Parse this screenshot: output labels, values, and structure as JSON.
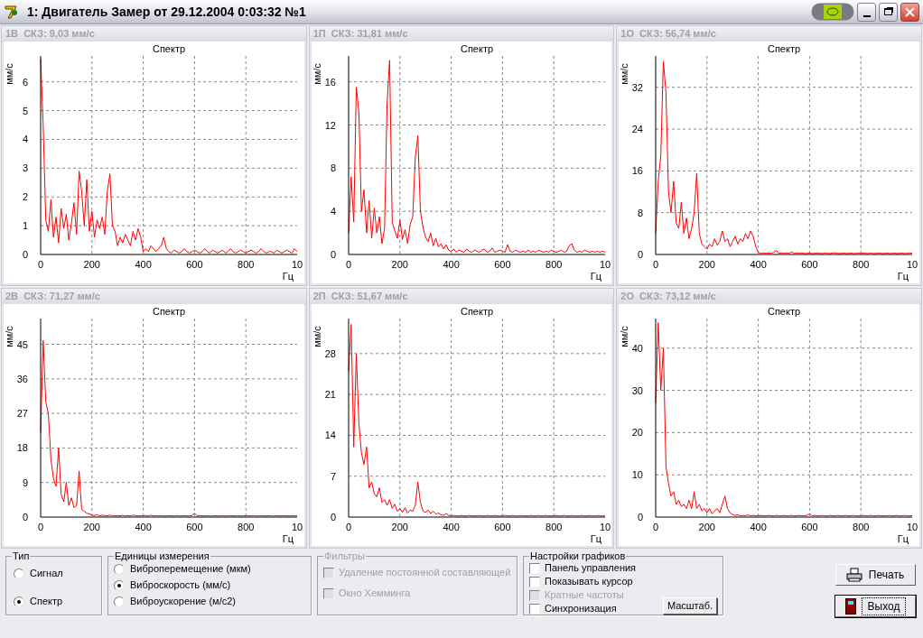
{
  "window": {
    "title": "1: Двигатель Замер от 29.12.2004 0:03:32  №1"
  },
  "charts": [
    {
      "header": "1В  СКЗ: 9,03 мм/с",
      "x_edge_label": "10",
      "chart_data": {
        "type": "line",
        "title": "Спектр",
        "xlabel": "Гц",
        "ylabel": "мм/с",
        "xlim": [
          0,
          1000
        ],
        "ylim": [
          0,
          6.9
        ],
        "grid": true,
        "xticks": [
          0,
          200,
          400,
          600,
          800
        ],
        "yticks": [
          0,
          1,
          2,
          3,
          4,
          5,
          6
        ],
        "x": [
          0,
          10,
          20,
          30,
          40,
          50,
          60,
          70,
          80,
          90,
          100,
          110,
          120,
          130,
          140,
          150,
          160,
          170,
          180,
          190,
          200,
          210,
          220,
          230,
          240,
          250,
          260,
          270,
          280,
          290,
          300,
          310,
          320,
          330,
          340,
          350,
          360,
          370,
          380,
          390,
          400,
          410,
          420,
          430,
          440,
          450,
          460,
          470,
          480,
          490,
          500,
          510,
          520,
          530,
          540,
          550,
          560,
          570,
          580,
          590,
          600,
          610,
          620,
          630,
          640,
          650,
          660,
          670,
          680,
          690,
          700,
          710,
          720,
          730,
          740,
          750,
          760,
          770,
          780,
          790,
          800,
          810,
          820,
          830,
          840,
          850,
          860,
          870,
          880,
          890,
          900,
          910,
          920,
          930,
          940,
          950,
          960,
          970,
          980,
          990,
          1000
        ],
        "series": [
          {
            "color": "#ff0000",
            "values": [
              6.8,
              4.5,
              1.2,
              0.8,
              1.9,
              0.6,
              1.3,
              0.4,
              1.6,
              0.9,
              1.4,
              0.5,
              1.1,
              1.8,
              0.7,
              2.9,
              2.2,
              1.0,
              2.6,
              0.8,
              1.5,
              0.6,
              1.2,
              0.9,
              1.3,
              0.7,
              2.2,
              2.8,
              1.0,
              0.8,
              0.3,
              0.6,
              0.4,
              0.7,
              0.5,
              0.3,
              0.8,
              0.5,
              0.9,
              0.6,
              0.1,
              0.2,
              0.1,
              0.3,
              0.2,
              0.1,
              0.2,
              0.3,
              0.6,
              0.2,
              0.1,
              0.05,
              0.15,
              0.1,
              0.05,
              0.1,
              0.2,
              0.1,
              0.05,
              0.1,
              0.15,
              0.1,
              0.05,
              0.1,
              0.2,
              0.1,
              0.05,
              0.15,
              0.1,
              0.05,
              0.1,
              0.15,
              0.05,
              0.1,
              0.2,
              0.1,
              0.05,
              0.1,
              0.15,
              0.1,
              0.05,
              0.1,
              0.15,
              0.1,
              0.05,
              0.1,
              0.2,
              0.1,
              0.05,
              0.1,
              0.1,
              0.05,
              0.15,
              0.1,
              0.05,
              0.1,
              0.15,
              0.1,
              0.05,
              0.2,
              0.1
            ]
          }
        ]
      }
    },
    {
      "header": "1П  СКЗ: 31,81 мм/с",
      "x_edge_label": "10",
      "chart_data": {
        "type": "line",
        "title": "Спектр",
        "xlabel": "Гц",
        "ylabel": "мм/с",
        "xlim": [
          0,
          1000
        ],
        "ylim": [
          0,
          18.4
        ],
        "grid": true,
        "xticks": [
          0,
          200,
          400,
          600,
          800
        ],
        "yticks": [
          0,
          4,
          8,
          12,
          16
        ],
        "x": [
          0,
          10,
          20,
          30,
          40,
          50,
          60,
          70,
          80,
          90,
          100,
          110,
          120,
          130,
          140,
          150,
          160,
          170,
          180,
          190,
          200,
          210,
          220,
          230,
          240,
          250,
          260,
          270,
          280,
          290,
          300,
          310,
          320,
          330,
          340,
          350,
          360,
          370,
          380,
          390,
          400,
          410,
          420,
          430,
          440,
          450,
          460,
          470,
          480,
          490,
          500,
          510,
          520,
          530,
          540,
          550,
          560,
          570,
          580,
          590,
          600,
          610,
          620,
          630,
          640,
          650,
          660,
          670,
          680,
          690,
          700,
          710,
          720,
          730,
          740,
          750,
          760,
          770,
          780,
          790,
          800,
          810,
          820,
          830,
          840,
          850,
          860,
          870,
          880,
          890,
          900,
          910,
          920,
          930,
          940,
          950,
          960,
          970,
          980,
          990,
          1000
        ],
        "series": [
          {
            "color": "#ff0000",
            "values": [
              2,
              7.2,
              3,
              15.5,
              13.2,
              4,
              6,
              2,
              5,
              1.5,
              4.3,
              2,
              3.5,
              1,
              2.4,
              14,
              18,
              3,
              2.2,
              1.5,
              3.2,
              1.4,
              2.3,
              1,
              2.8,
              3.5,
              9,
              11,
              4,
              2.5,
              1.6,
              1.2,
              2,
              0.8,
              1.5,
              0.7,
              1,
              0.5,
              0.9,
              0.4,
              0.3,
              0.5,
              0.2,
              0.4,
              0.3,
              0.2,
              0.5,
              0.3,
              0.2,
              0.4,
              0.3,
              0.2,
              0.4,
              0.5,
              0.2,
              0.3,
              0.6,
              0.2,
              0.3,
              0.4,
              0.3,
              0.2,
              0.9,
              0.3,
              0.2,
              0.4,
              0.3,
              0.2,
              0.3,
              0.2,
              0.4,
              0.2,
              0.3,
              0.2,
              0.4,
              0.3,
              0.2,
              0.3,
              0.2,
              0.4,
              0.3,
              0.2,
              0.3,
              0.4,
              0.2,
              0.3,
              0.8,
              1.0,
              0.4,
              0.2,
              0.3,
              0.2,
              0.4,
              0.3,
              0.2,
              0.3,
              0.2,
              0.3,
              0.2,
              0.3,
              0.2
            ]
          }
        ]
      }
    },
    {
      "header": "1О  СКЗ: 56,74 мм/с",
      "x_edge_label": "10",
      "chart_data": {
        "type": "line",
        "title": "Спектр",
        "xlabel": "Гц",
        "ylabel": "мм/с",
        "xlim": [
          0,
          1000
        ],
        "ylim": [
          0,
          38
        ],
        "grid": true,
        "xticks": [
          0,
          200,
          400,
          600,
          800
        ],
        "yticks": [
          0,
          8,
          16,
          24,
          32
        ],
        "x": [
          0,
          10,
          20,
          30,
          40,
          50,
          60,
          70,
          80,
          90,
          100,
          110,
          120,
          130,
          140,
          150,
          160,
          170,
          180,
          190,
          200,
          210,
          220,
          230,
          240,
          250,
          260,
          270,
          280,
          290,
          300,
          310,
          320,
          330,
          340,
          350,
          360,
          370,
          380,
          390,
          400,
          410,
          420,
          430,
          440,
          450,
          460,
          470,
          480,
          490,
          500,
          510,
          520,
          530,
          540,
          550,
          560,
          570,
          580,
          590,
          600,
          610,
          620,
          630,
          640,
          650,
          660,
          670,
          680,
          690,
          700,
          710,
          720,
          730,
          740,
          750,
          760,
          770,
          780,
          790,
          800,
          810,
          820,
          830,
          840,
          850,
          860,
          870,
          880,
          890,
          900,
          910,
          920,
          930,
          940,
          950,
          960,
          970,
          980,
          990,
          1000
        ],
        "series": [
          {
            "color": "#ff0000",
            "values": [
              4,
              14,
              19,
              37,
              31,
              12,
              8,
              14,
              6,
              5,
              10,
              4,
              7,
              3,
              5,
              8,
              15.5,
              4,
              2,
              1.5,
              1,
              2,
              1.5,
              3,
              1.8,
              2.5,
              4.5,
              2.5,
              3,
              1.5,
              2.5,
              3.5,
              2,
              3,
              2.5,
              4,
              3,
              4.5,
              3.5,
              1.5,
              0.4,
              0.2,
              0.3,
              0.2,
              0.3,
              0.2,
              0.4,
              0.8,
              0.2,
              0.3,
              0.2,
              0.3,
              0.2,
              0.5,
              0.2,
              0.3,
              0.2,
              0.3,
              0.2,
              0.2,
              0.3,
              0.2,
              0.2,
              0.3,
              0.2,
              0.2,
              0.3,
              0.2,
              0.2,
              0.3,
              0.3,
              0.2,
              0.2,
              0.3,
              0.2,
              0.2,
              0.3,
              0.2,
              0.2,
              0.3,
              0.2,
              0.3,
              0.2,
              0.2,
              0.3,
              0.2,
              0.2,
              0.3,
              0.2,
              0.2,
              0.3,
              0.2,
              0.2,
              0.3,
              0.2,
              0.2,
              0.3,
              0.2,
              0.2,
              0.3,
              0.2
            ]
          }
        ]
      }
    },
    {
      "header": "2В  СКЗ: 71,27 мм/с",
      "x_edge_label": "10",
      "chart_data": {
        "type": "line",
        "title": "Спектр",
        "xlabel": "Гц",
        "ylabel": "мм/с",
        "xlim": [
          0,
          1000
        ],
        "ylim": [
          0,
          51.7
        ],
        "grid": true,
        "xticks": [
          0,
          200,
          400,
          600,
          800
        ],
        "yticks": [
          0,
          9,
          18,
          27,
          36,
          45
        ],
        "x": [
          0,
          10,
          20,
          30,
          40,
          50,
          60,
          70,
          80,
          90,
          100,
          110,
          120,
          130,
          140,
          150,
          160,
          170,
          180,
          190,
          200,
          210,
          220,
          230,
          240,
          250,
          260,
          270,
          280,
          290,
          300,
          310,
          320,
          330,
          340,
          350,
          360,
          370,
          380,
          390,
          400,
          410,
          420,
          430,
          440,
          450,
          460,
          470,
          480,
          490,
          500,
          510,
          520,
          530,
          540,
          550,
          560,
          570,
          580,
          590,
          600,
          610,
          620,
          630,
          640,
          650,
          660,
          670,
          680,
          690,
          700,
          710,
          720,
          730,
          740,
          750,
          760,
          770,
          780,
          790,
          800,
          810,
          820,
          830,
          840,
          850,
          860,
          870,
          880,
          890,
          900,
          910,
          920,
          930,
          940,
          950,
          960,
          970,
          980,
          990,
          1000
        ],
        "series": [
          {
            "color": "#ff0000",
            "values": [
              22,
              46,
              30,
              27,
              15,
              10,
              8,
              18,
              6,
              4,
              9,
              3,
              5,
              2.5,
              3,
              12,
              2,
              1.5,
              1,
              0.8,
              0.5,
              0.4,
              0.6,
              0.3,
              0.5,
              0.4,
              0.3,
              0.5,
              0.4,
              0.3,
              0.4,
              0.3,
              0.5,
              0.3,
              0.4,
              0.3,
              0.5,
              0.4,
              0.3,
              0.4,
              0.3,
              0.4,
              0.3,
              0.5,
              0.3,
              0.4,
              0.3,
              0.4,
              0.3,
              0.3,
              0.4,
              0.3,
              0.3,
              0.4,
              0.3,
              0.3,
              0.4,
              0.3,
              0.3,
              0.4,
              1,
              0.3,
              0.4,
              0.3,
              0.3,
              0.4,
              0.3,
              0.3,
              0.4,
              0.3,
              0.3,
              0.4,
              0.3,
              0.3,
              0.4,
              0.3,
              0.3,
              0.4,
              0.3,
              0.3,
              0.4,
              0.3,
              0.3,
              0.4,
              0.3,
              0.3,
              0.4,
              0.3,
              0.3,
              0.4,
              0.3,
              0.3,
              0.4,
              0.3,
              0.3,
              0.4,
              0.3,
              0.3,
              0.4,
              0.3,
              0.3
            ]
          }
        ]
      }
    },
    {
      "header": "2П  СКЗ: 51,67 мм/с",
      "x_edge_label": "10",
      "chart_data": {
        "type": "line",
        "title": "Спектр",
        "xlabel": "Гц",
        "ylabel": "мм/с",
        "xlim": [
          0,
          1000
        ],
        "ylim": [
          0,
          34
        ],
        "grid": true,
        "xticks": [
          0,
          200,
          400,
          600,
          800
        ],
        "yticks": [
          0,
          7,
          14,
          21,
          28
        ],
        "x": [
          0,
          10,
          20,
          30,
          40,
          50,
          60,
          70,
          80,
          90,
          100,
          110,
          120,
          130,
          140,
          150,
          160,
          170,
          180,
          190,
          200,
          210,
          220,
          230,
          240,
          250,
          260,
          270,
          280,
          290,
          300,
          310,
          320,
          330,
          340,
          350,
          360,
          370,
          380,
          390,
          400,
          410,
          420,
          430,
          440,
          450,
          460,
          470,
          480,
          490,
          500,
          510,
          520,
          530,
          540,
          550,
          560,
          570,
          580,
          590,
          600,
          610,
          620,
          630,
          640,
          650,
          660,
          670,
          680,
          690,
          700,
          710,
          720,
          730,
          740,
          750,
          760,
          770,
          780,
          790,
          800,
          810,
          820,
          830,
          840,
          850,
          860,
          870,
          880,
          890,
          900,
          910,
          920,
          930,
          940,
          950,
          960,
          970,
          980,
          990,
          1000
        ],
        "series": [
          {
            "color": "#ff0000",
            "values": [
              25,
              33,
              12,
              28,
              16,
              11,
              9,
              12,
              5,
              6,
              4,
              3.5,
              5,
              2.5,
              3,
              2,
              3,
              1.5,
              2.2,
              1,
              1.5,
              0.8,
              1.6,
              0.7,
              1.2,
              1,
              2,
              6,
              2.5,
              1,
              0.8,
              1.2,
              0.6,
              1,
              0.5,
              0.7,
              0.4,
              0.3,
              0.6,
              0.3,
              0.2,
              0.3,
              0.2,
              0.2,
              0.3,
              0.2,
              0.2,
              0.3,
              0.2,
              0.2,
              0.2,
              0.3,
              0.2,
              0.2,
              0.3,
              0.2,
              0.2,
              0.3,
              0.2,
              0.2,
              0.2,
              0.3,
              0.2,
              0.2,
              0.3,
              0.2,
              0.2,
              0.3,
              0.2,
              0.2,
              0.2,
              0.3,
              0.2,
              0.2,
              0.3,
              0.2,
              0.2,
              0.3,
              0.2,
              0.2,
              0.2,
              0.3,
              0.2,
              0.2,
              0.3,
              0.2,
              0.2,
              0.3,
              0.2,
              0.2,
              0.2,
              0.3,
              0.2,
              0.2,
              0.3,
              0.2,
              0.2,
              0.3,
              0.2,
              0.2,
              0.2
            ]
          }
        ]
      }
    },
    {
      "header": "2О  СКЗ: 73,12 мм/с",
      "x_edge_label": "10",
      "chart_data": {
        "type": "line",
        "title": "Спектр",
        "xlabel": "Гц",
        "ylabel": "мм/с",
        "xlim": [
          0,
          1000
        ],
        "ylim": [
          0,
          47
        ],
        "grid": true,
        "xticks": [
          0,
          200,
          400,
          600,
          800
        ],
        "yticks": [
          0,
          10,
          20,
          30,
          40
        ],
        "x": [
          0,
          10,
          20,
          30,
          40,
          50,
          60,
          70,
          80,
          90,
          100,
          110,
          120,
          130,
          140,
          150,
          160,
          170,
          180,
          190,
          200,
          210,
          220,
          230,
          240,
          250,
          260,
          270,
          280,
          290,
          300,
          310,
          320,
          330,
          340,
          350,
          360,
          370,
          380,
          390,
          400,
          410,
          420,
          430,
          440,
          450,
          460,
          470,
          480,
          490,
          500,
          510,
          520,
          530,
          540,
          550,
          560,
          570,
          580,
          590,
          600,
          610,
          620,
          630,
          640,
          650,
          660,
          670,
          680,
          690,
          700,
          710,
          720,
          730,
          740,
          750,
          760,
          770,
          780,
          790,
          800,
          810,
          820,
          830,
          840,
          850,
          860,
          870,
          880,
          890,
          900,
          910,
          920,
          930,
          940,
          950,
          960,
          970,
          980,
          990,
          1000
        ],
        "series": [
          {
            "color": "#ff0000",
            "values": [
              27,
              46,
              30,
              40,
              12,
              8,
              5,
              6,
              3,
              4,
              2.5,
              3,
              2,
              4,
              2,
              6,
              2,
              3,
              1.5,
              2,
              1,
              2,
              0.8,
              1.5,
              2,
              1,
              3,
              5,
              2,
              1,
              0.6,
              0.4,
              0.5,
              0.3,
              0.4,
              0.3,
              0.5,
              0.3,
              0.4,
              0.3,
              0.3,
              0.4,
              0.3,
              0.3,
              0.4,
              0.3,
              0.3,
              0.4,
              0.3,
              0.3,
              0.4,
              0.3,
              0.3,
              0.4,
              0.3,
              0.3,
              0.4,
              0.3,
              0.3,
              0.4,
              0.8,
              0.3,
              0.4,
              0.3,
              0.3,
              0.4,
              0.3,
              0.3,
              0.4,
              0.3,
              0.3,
              0.4,
              0.3,
              0.3,
              0.4,
              0.3,
              0.3,
              0.4,
              0.3,
              0.3,
              0.3,
              0.4,
              0.3,
              0.3,
              0.4,
              0.3,
              0.3,
              0.4,
              0.3,
              0.3,
              0.3,
              0.4,
              0.3,
              0.3,
              0.4,
              0.3,
              0.3,
              0.4,
              0.3,
              0.3,
              0.3
            ]
          }
        ]
      }
    }
  ],
  "type_group": {
    "title": "Тип",
    "options": [
      {
        "label": "Сигнал",
        "selected": false
      },
      {
        "label": "Спектр",
        "selected": true
      }
    ]
  },
  "units_group": {
    "title": "Единицы измерения",
    "options": [
      {
        "label": "Виброперемещение (мкм)",
        "selected": false
      },
      {
        "label": "Виброскорость (мм/с)",
        "selected": true
      },
      {
        "label": "Виброускорение (м/с2)",
        "selected": false
      }
    ]
  },
  "filters_group": {
    "title": "Фильтры",
    "options": [
      {
        "label": "Удаление постоянной составляющей",
        "checked": false,
        "disabled": true
      },
      {
        "label": "Окно Хемминга",
        "checked": false,
        "disabled": true
      }
    ]
  },
  "chart_settings": {
    "title": "Настройки графиков",
    "options": [
      {
        "label": "Панель управления",
        "checked": false,
        "disabled": false
      },
      {
        "label": "Показывать курсор",
        "checked": false,
        "disabled": false
      },
      {
        "label": "Кратные частоты",
        "checked": false,
        "disabled": true
      },
      {
        "label": "Синхронизация",
        "checked": false,
        "disabled": false
      }
    ],
    "button": "Масштаб."
  },
  "buttons": [
    {
      "label": "Печать",
      "kind": "print",
      "focused": false
    },
    {
      "label": "Выход",
      "kind": "exit",
      "focused": true
    }
  ]
}
